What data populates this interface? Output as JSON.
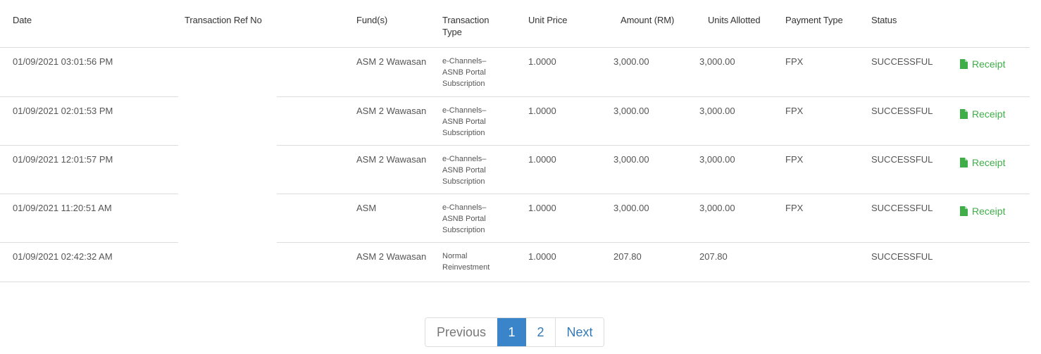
{
  "table": {
    "headers": {
      "date": "Date",
      "ref": "Transaction Ref No",
      "fund": "Fund(s)",
      "type": "Transaction Type",
      "price": "Unit Price",
      "amount": "Amount (RM)",
      "units": "Units Allotted",
      "payment": "Payment Type",
      "status": "Status"
    },
    "rows": [
      {
        "date": "01/09/2021 03:01:56 PM",
        "ref": "",
        "fund": "ASM 2 Wawasan",
        "type": "e-Channels–ASNB Portal Subscription",
        "price": "1.0000",
        "amount": "3,000.00",
        "units": "3,000.00",
        "payment": "FPX",
        "status": "SUCCESSFUL",
        "receipt": "Receipt"
      },
      {
        "date": "01/09/2021 02:01:53 PM",
        "ref": "",
        "fund": "ASM 2 Wawasan",
        "type": "e-Channels–ASNB Portal Subscription",
        "price": "1.0000",
        "amount": "3,000.00",
        "units": "3,000.00",
        "payment": "FPX",
        "status": "SUCCESSFUL",
        "receipt": "Receipt"
      },
      {
        "date": "01/09/2021 12:01:57 PM",
        "ref": "",
        "fund": "ASM 2 Wawasan",
        "type": "e-Channels–ASNB Portal Subscription",
        "price": "1.0000",
        "amount": "3,000.00",
        "units": "3,000.00",
        "payment": "FPX",
        "status": "SUCCESSFUL",
        "receipt": "Receipt"
      },
      {
        "date": "01/09/2021 11:20:51 AM",
        "ref": "",
        "fund": "ASM",
        "type": "e-Channels–ASNB Portal Subscription",
        "price": "1.0000",
        "amount": "3,000.00",
        "units": "3,000.00",
        "payment": "FPX",
        "status": "SUCCESSFUL",
        "receipt": "Receipt"
      },
      {
        "date": "01/09/2021 02:42:32 AM",
        "ref": "",
        "fund": "ASM 2 Wawasan",
        "type": "Normal Reinvestment",
        "price": "1.0000",
        "amount": "207.80",
        "units": "207.80",
        "payment": "",
        "status": "SUCCESSFUL",
        "receipt": ""
      }
    ]
  },
  "pagination": {
    "previous": "Previous",
    "page1": "1",
    "page2": "2",
    "next": "Next"
  },
  "colors": {
    "receipt": "#3fae49",
    "active_page": "#3a84c9",
    "link": "#337ab7"
  },
  "icons": {
    "receipt": "file-icon"
  }
}
